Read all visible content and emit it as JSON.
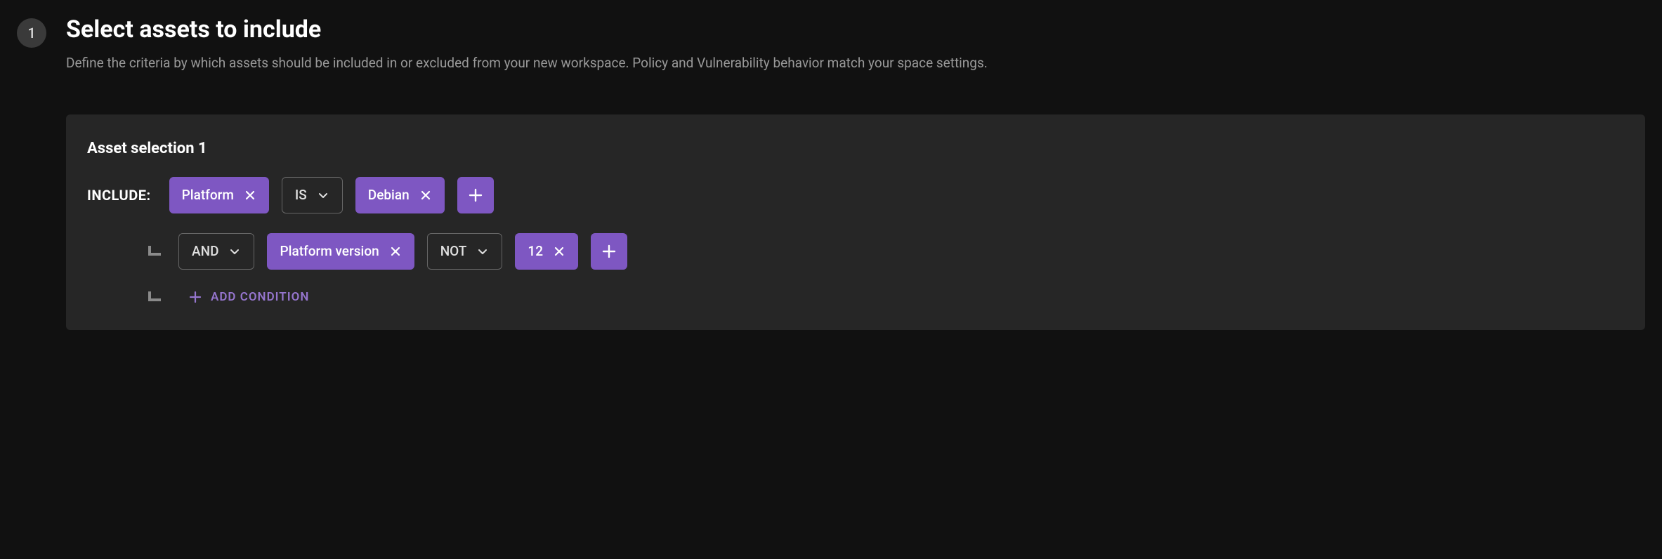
{
  "step": {
    "number": "1"
  },
  "header": {
    "title": "Select assets to include",
    "subtitle": "Define the criteria by which assets should be included in or excluded from your new workspace. Policy and Vulnerability behavior match your space settings."
  },
  "panel": {
    "title": "Asset selection 1",
    "include_label": "INCLUDE:",
    "row1": {
      "field": "Platform",
      "operator": "IS",
      "value": "Debian"
    },
    "row2": {
      "conjunction": "AND",
      "field": "Platform version",
      "operator": "NOT",
      "value": "12"
    },
    "add_condition_label": "ADD CONDITION"
  }
}
